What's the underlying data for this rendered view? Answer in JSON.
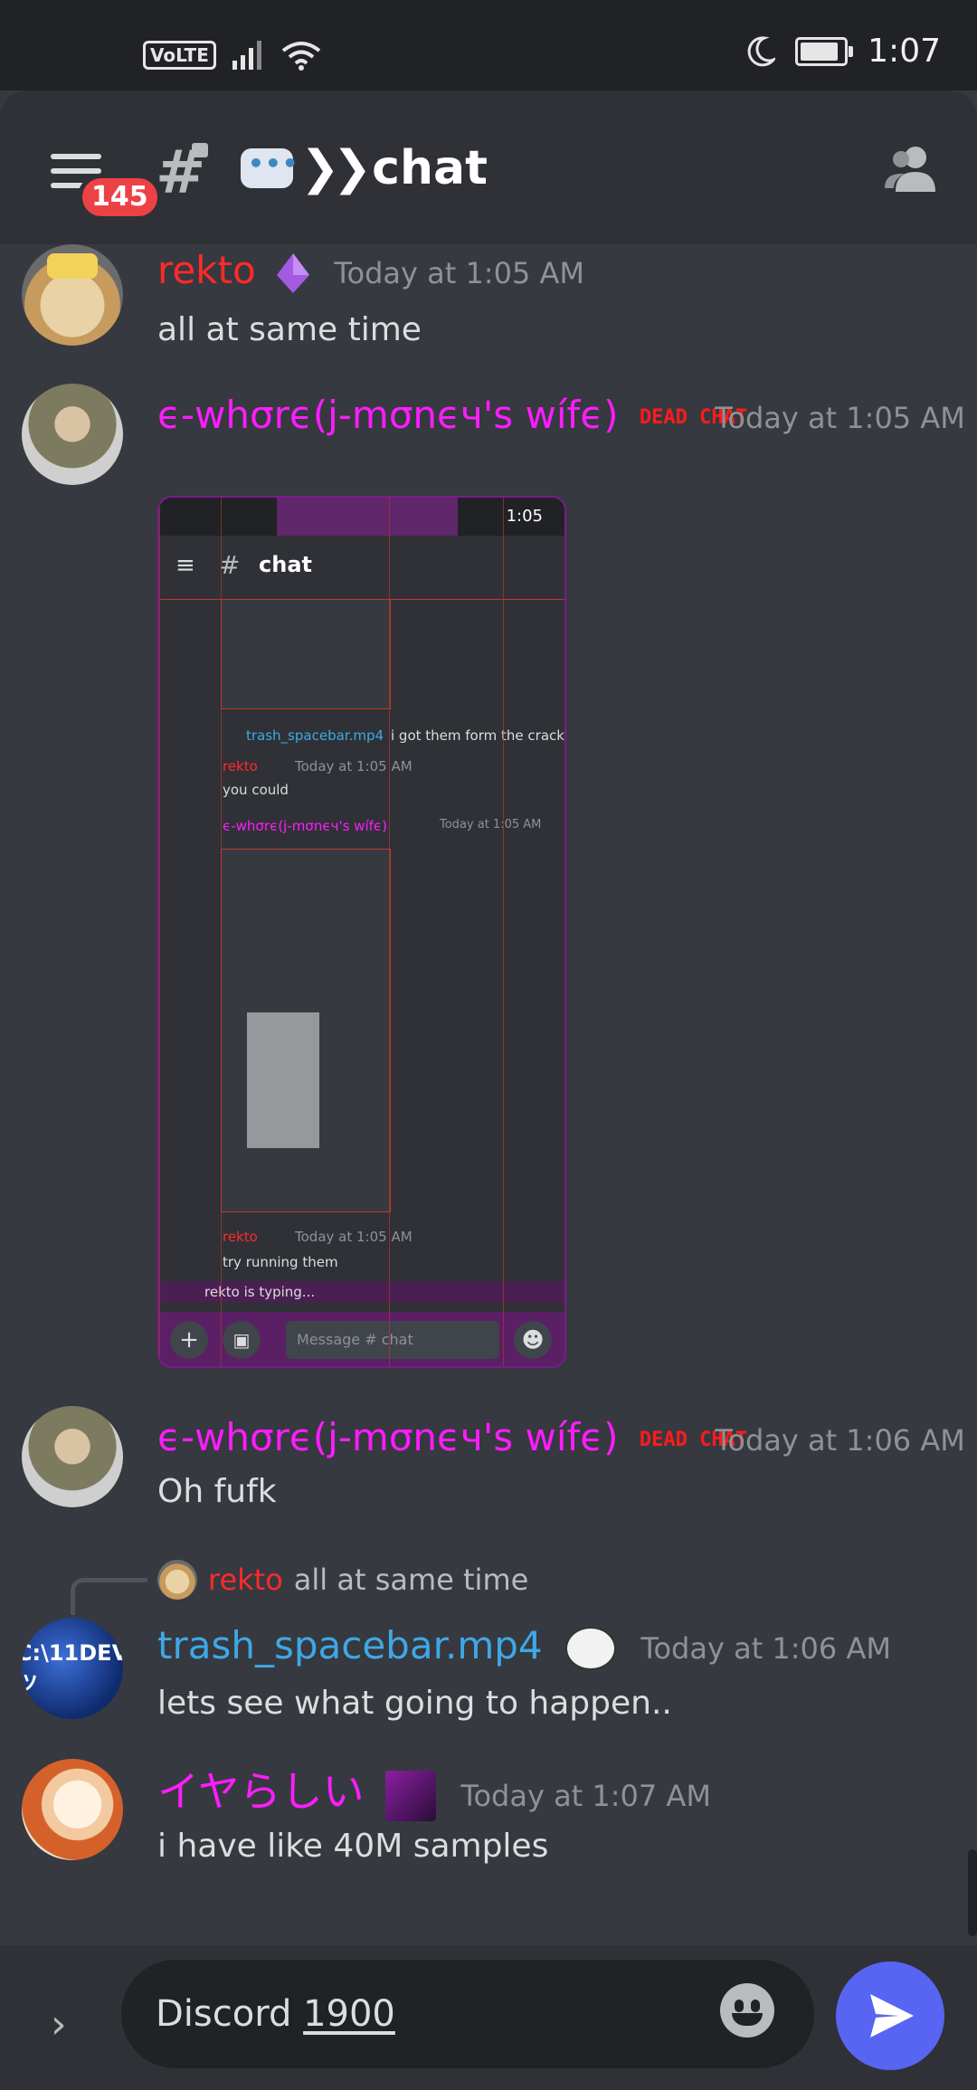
{
  "status_bar": {
    "volte": "VoLTE",
    "time": "1:07"
  },
  "header": {
    "notification_count": "145",
    "channel_name": "chat",
    "channel_prefix_emoji": "speech-balloon"
  },
  "messages": [
    {
      "author": "rekto",
      "author_color": "#ff2a2a",
      "timestamp": "Today at 1:05 AM",
      "text": "all at same time"
    },
    {
      "author": "ϵ-whσrϵ(j-mσnϵч's wífϵ)",
      "author_color": "#ff1cff",
      "timestamp": "Today at 1:05 AM",
      "text": ""
    },
    {
      "author": "ϵ-whσrϵ(j-mσnϵч's wífϵ)",
      "author_color": "#ff1cff",
      "timestamp": "Today at 1:06 AM",
      "text": "Oh fufk"
    },
    {
      "author": "trash_spacebar.mp4",
      "author_color": "#3ea8e6",
      "timestamp": "Today at 1:06 AM",
      "text": "lets see what going to happen.."
    },
    {
      "author": "イヤらしい",
      "author_color": "#ff1cff",
      "timestamp": "Today at 1:07 AM",
      "text": "i have like 40M samples"
    }
  ],
  "role_badge": {
    "dead_chat": "DEAD CHAT"
  },
  "avatars": {
    "dev": "C:\\11DEVツ"
  },
  "reply": {
    "author": "rekto",
    "text": "all at same time"
  },
  "embed": {
    "time": "1:05",
    "channel": "chat",
    "row1_author": "trash_spacebar.mp4",
    "row1_text": "i got them form the cracked",
    "row2_author": "rekto",
    "row2_ts": "Today at 1:05 AM",
    "row2_text": "you could",
    "row3_author": "ϵ-whσrϵ(j-mσnϵч's wífϵ)",
    "row3_ts": "Today at 1:05 AM",
    "row4_author": "rekto",
    "row4_ts": "Today at 1:05 AM",
    "row4_text": "try running them",
    "typing": "rekto is typing...",
    "input_placeholder": "Message # chat"
  },
  "composer": {
    "value_prefix": "Discord ",
    "value_underlined": "1900"
  }
}
